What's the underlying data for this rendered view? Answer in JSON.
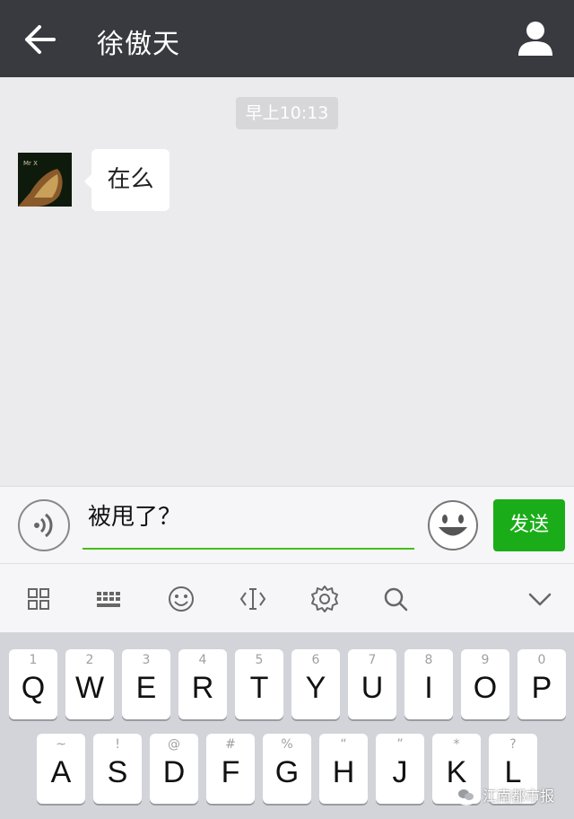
{
  "header": {
    "title": "徐傲天",
    "back_icon": "arrow-left-icon",
    "profile_icon": "user-icon"
  },
  "chat": {
    "timestamp": "早上10:13",
    "messages": [
      {
        "sender": "contact",
        "text": "在么",
        "avatar_text": "Mr X"
      }
    ]
  },
  "input_bar": {
    "voice_icon": "voice-icon",
    "message_value": "被甩了？",
    "emoji_icon": "emoji-icon",
    "send_label": "发送",
    "colors": {
      "send": "#1aad19",
      "underline": "#45c01a"
    }
  },
  "toolbar": {
    "icons": [
      "grid-icon",
      "keyboard-icon",
      "smiley-icon",
      "cursor-icon",
      "settings-icon",
      "search-icon",
      "chevron-down-icon"
    ]
  },
  "keyboard": {
    "row1": [
      {
        "char": "Q",
        "hint": "1"
      },
      {
        "char": "W",
        "hint": "2"
      },
      {
        "char": "E",
        "hint": "3"
      },
      {
        "char": "R",
        "hint": "4"
      },
      {
        "char": "T",
        "hint": "5"
      },
      {
        "char": "Y",
        "hint": "6"
      },
      {
        "char": "U",
        "hint": "7"
      },
      {
        "char": "I",
        "hint": "8"
      },
      {
        "char": "O",
        "hint": "9"
      },
      {
        "char": "P",
        "hint": "0"
      }
    ],
    "row2": [
      {
        "char": "A",
        "hint": "~"
      },
      {
        "char": "S",
        "hint": "!"
      },
      {
        "char": "D",
        "hint": "@"
      },
      {
        "char": "F",
        "hint": "#"
      },
      {
        "char": "G",
        "hint": "%"
      },
      {
        "char": "H",
        "hint": "“"
      },
      {
        "char": "J",
        "hint": "”"
      },
      {
        "char": "K",
        "hint": "*"
      },
      {
        "char": "L",
        "hint": "?"
      }
    ]
  },
  "watermark": {
    "text": "江南都市报"
  }
}
